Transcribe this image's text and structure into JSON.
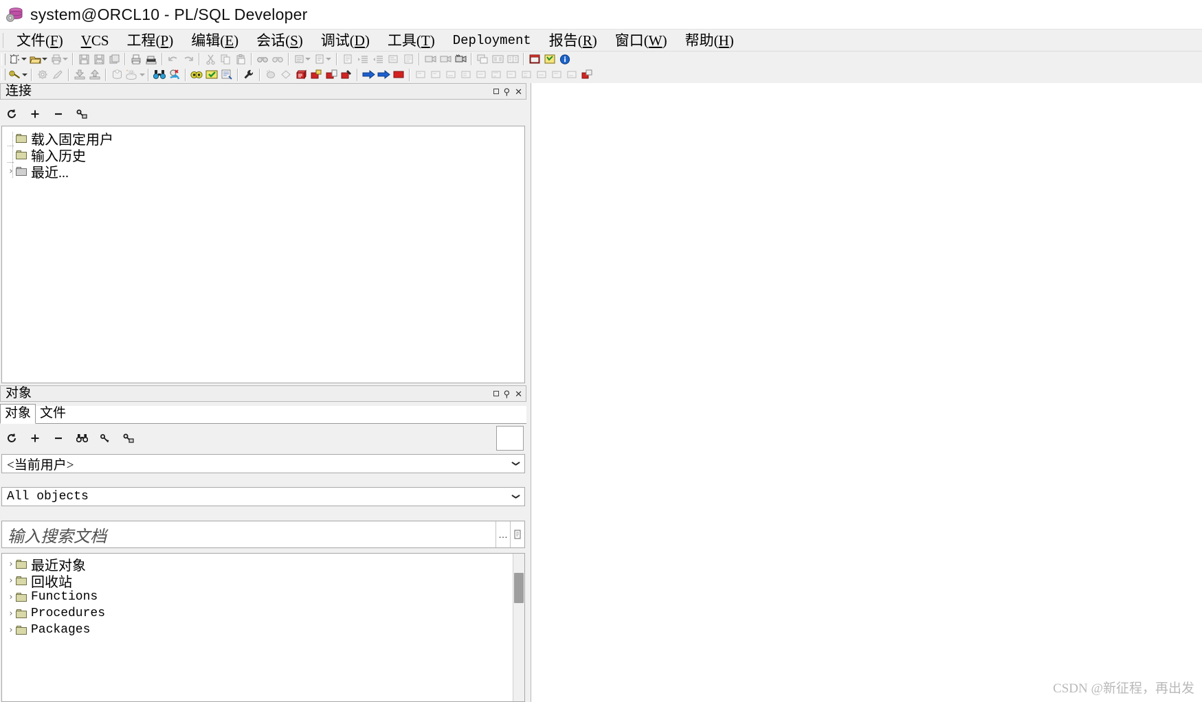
{
  "window": {
    "title": "system@ORCL10 - PL/SQL Developer",
    "app_icon": "database-cylinder-icon"
  },
  "menubar": {
    "items": [
      {
        "label": "文件",
        "accel": "F",
        "mono": false
      },
      {
        "label": "VCS",
        "accel": "V",
        "mono": false,
        "accel_inline": true
      },
      {
        "label": "工程",
        "accel": "P",
        "mono": false
      },
      {
        "label": "编辑",
        "accel": "E",
        "mono": false
      },
      {
        "label": "会话",
        "accel": "S",
        "mono": false
      },
      {
        "label": "调试",
        "accel": "D",
        "mono": false
      },
      {
        "label": "工具",
        "accel": "T",
        "mono": false
      },
      {
        "label": "Deployment",
        "accel": "",
        "mono": true
      },
      {
        "label": "报告",
        "accel": "R",
        "mono": false
      },
      {
        "label": "窗口",
        "accel": "W",
        "mono": false
      },
      {
        "label": "帮助",
        "accel": "H",
        "mono": false
      }
    ]
  },
  "toolbar_row1": {
    "groups": [
      [
        "new-document-icon",
        "open-folder-icon",
        "print-icon"
      ],
      [
        "save-icon",
        "save-as-icon",
        "save-all-icon"
      ],
      [
        "print-page-icon",
        "print-setup-icon"
      ],
      [
        "undo-icon",
        "redo-icon"
      ],
      [
        "cut-icon",
        "copy-icon",
        "paste-icon"
      ],
      [
        "find-icon",
        "find-next-icon"
      ],
      [
        "comment-icon",
        "uncomment-icon"
      ],
      [
        "clear-icon",
        "indent-icon",
        "outdent-icon",
        "align-left-icon",
        "align-right-icon"
      ],
      [
        "record-macro-icon",
        "stop-macro-icon",
        "play-macro-icon"
      ],
      [
        "window-cascade-icon",
        "window-tile-h-icon",
        "window-tile-v-icon"
      ],
      [
        "close-window-icon",
        "object-browser-icon",
        "info-icon"
      ]
    ]
  },
  "toolbar_row2": {
    "groups": [
      [
        "key-login-icon"
      ],
      [
        "session-settings-icon",
        "commit-pen-icon"
      ],
      [
        "import-icon",
        "export-icon"
      ],
      [
        "rollback-icon",
        "sql-plus-icon"
      ],
      [
        "binoculars-icon",
        "explain-plan-icon"
      ],
      [
        "test-window-icon",
        "command-window-icon",
        "report-window-icon"
      ],
      [
        "wrench-icon"
      ],
      [
        "new-object-icon",
        "diagram-icon",
        "package-red-icon",
        "folder-red-icon",
        "copy-red-icon",
        "tools-red-icon"
      ],
      [
        "run-blue-arrow-icon",
        "step-red-arrow-icon",
        "stop-red-icon"
      ],
      [
        "debug-1-icon",
        "debug-2-icon",
        "debug-3-icon",
        "debug-4-icon",
        "debug-5-icon",
        "debug-6-icon",
        "debug-7-icon",
        "debug-8-icon",
        "debug-9-icon",
        "debug-10-icon",
        "debug-11-icon"
      ],
      [
        "browser-red-icon"
      ]
    ]
  },
  "connections_panel": {
    "title": "连接",
    "header_buttons": [
      "restore-button",
      "pin-button",
      "close-button"
    ],
    "toolbar": [
      {
        "name": "refresh-icon",
        "glyph": "↻"
      },
      {
        "name": "add-icon",
        "glyph": "✛"
      },
      {
        "name": "remove-icon",
        "glyph": "—"
      },
      {
        "name": "edit-key-icon",
        "glyph": "⚿"
      }
    ],
    "tree": [
      {
        "label": "载入固定用户",
        "expander": "",
        "icon": "folder-icon",
        "color": "olive"
      },
      {
        "label": "输入历史",
        "expander": "",
        "icon": "folder-icon",
        "color": "olive"
      },
      {
        "label": "最近...",
        "expander": "›",
        "icon": "folder-icon",
        "color": "grey"
      }
    ]
  },
  "objects_panel": {
    "title": "对象",
    "header_buttons": [
      "restore-button",
      "pin-button",
      "close-button"
    ],
    "tabs": [
      {
        "label": "对象",
        "active": true
      },
      {
        "label": "文件",
        "active": false
      }
    ],
    "toolbar": [
      {
        "name": "refresh-icon",
        "glyph": "↻"
      },
      {
        "name": "add-icon",
        "glyph": "✛"
      },
      {
        "name": "remove-icon",
        "glyph": "—"
      },
      {
        "name": "binoculars-icon",
        "glyph": "👓"
      },
      {
        "name": "filter-icon",
        "glyph": "⚘"
      },
      {
        "name": "edit-key-icon",
        "glyph": "⚿"
      }
    ],
    "user_combo": {
      "value": "<当前用户>",
      "name": "user-select"
    },
    "filter_combo": {
      "value": "All objects",
      "name": "object-filter-select"
    },
    "search": {
      "placeholder": "输入搜索文档",
      "buttons": [
        "more-options-button",
        "copy-doc-button"
      ]
    },
    "tree": [
      {
        "label": "最近对象",
        "expander": "›",
        "icon": "folder-icon",
        "mono": false
      },
      {
        "label": "回收站",
        "expander": "›",
        "icon": "folder-icon",
        "mono": false
      },
      {
        "label": "Functions",
        "expander": "›",
        "icon": "folder-icon",
        "mono": true
      },
      {
        "label": "Procedures",
        "expander": "›",
        "icon": "folder-icon",
        "mono": true
      },
      {
        "label": "Packages",
        "expander": "›",
        "icon": "folder-icon",
        "mono": true
      }
    ]
  },
  "workarea": {
    "watermark": "CSDN @新征程，再出发"
  },
  "colors": {
    "chrome": "#f0f0f0",
    "panel_border": "#b9b9b9",
    "folder_olive": "#d8d8a8",
    "accent_blue": "#1c5fd0",
    "accent_red": "#d42020",
    "watermark": "#b9b9b9"
  }
}
